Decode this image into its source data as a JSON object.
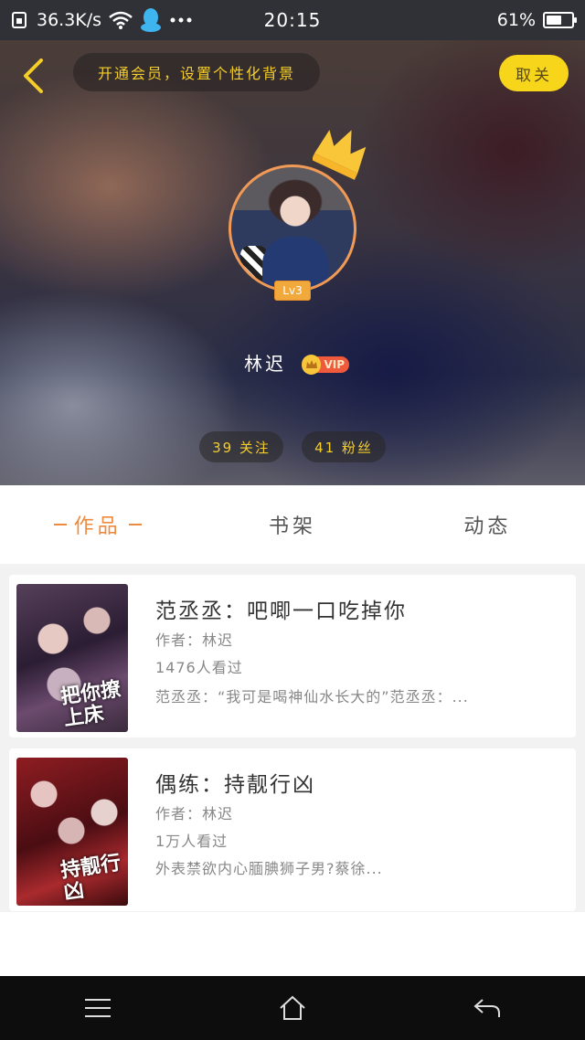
{
  "status_bar": {
    "net_speed": "36.3K/s",
    "time": "20:15",
    "battery": "61%",
    "battery_level": 0.61,
    "icons": [
      "sim-icon",
      "wifi-icon",
      "qq-icon",
      "more-dots-icon",
      "battery-icon"
    ]
  },
  "header": {
    "vip_banner": "开通会员，设置个性化背景",
    "cancel_label": "取关"
  },
  "profile": {
    "level": "Lv3",
    "name": "林迟",
    "vip_label": "VIP",
    "follow_label": "39 关注",
    "fans_label": "41 粉丝"
  },
  "tabs": [
    {
      "label": "作品",
      "active": true
    },
    {
      "label": "书架",
      "active": false
    },
    {
      "label": "动态",
      "active": false
    }
  ],
  "books": [
    {
      "title": "范丞丞：吧唧一口吃掉你",
      "author": "作者：林迟",
      "views": "1476人看过",
      "desc": "范丞丞：“我可是喝神仙水长大的”范丞丞：...",
      "cover_text": "把你撩上床"
    },
    {
      "title": "偶练：持靓行凶",
      "author": "作者：林迟",
      "views": "1万人看过",
      "desc": "外表禁欲内心腼腆狮子男?蔡徐...",
      "cover_text": "持靓行凶"
    }
  ],
  "colors": {
    "accent_orange": "#ee8a3e",
    "accent_yellow": "#f7d51b",
    "vip_red": "#f05a3c"
  }
}
